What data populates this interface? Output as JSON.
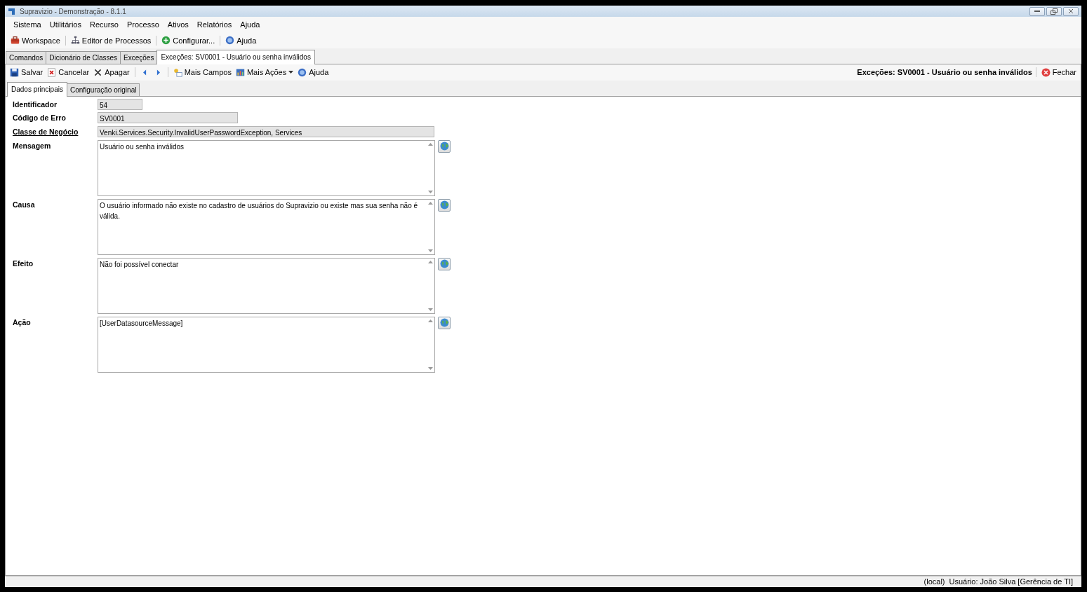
{
  "window": {
    "title": "Supravizio - Demonstração - 8.1.1"
  },
  "menu": [
    "Sistema",
    "Utilitários",
    "Recurso",
    "Processo",
    "Ativos",
    "Relatórios",
    "Ajuda"
  ],
  "toolbar": [
    "Workspace",
    "Editor de Processos",
    "Configurar...",
    "Ajuda"
  ],
  "doc_tabs": [
    {
      "label": "Comandos",
      "selected": false
    },
    {
      "label": "Dicionário de Classes",
      "selected": false
    },
    {
      "label": "Exceções",
      "selected": false
    },
    {
      "label": "Exceções: SV0001 - Usuário ou senha inválidos",
      "selected": true
    }
  ],
  "actions": [
    {
      "label": "Salvar",
      "dropdown": false
    },
    {
      "label": "Cancelar",
      "dropdown": false
    },
    {
      "label": "Apagar",
      "dropdown": false
    },
    {
      "dropdown": false
    },
    {
      "dropdown": false
    },
    {
      "label": "Mais Campos",
      "dropdown": false
    },
    {
      "label": "Mais Ações",
      "dropdown": true
    },
    {
      "label": "Ajuda",
      "dropdown": false
    }
  ],
  "document_title": "Exceções: SV0001 - Usuário ou senha inválidos",
  "close_button": "Fechar",
  "sub_tabs": [
    {
      "label": "Dados principais",
      "selected": true
    },
    {
      "label": "Configuração original",
      "selected": false
    }
  ],
  "fields": [
    {
      "kind": "text",
      "label": "Identificador",
      "value": "54",
      "link": false
    },
    {
      "kind": "text",
      "label": "Código de Erro",
      "value": "SV0001",
      "link": false
    },
    {
      "kind": "text",
      "label": "Classe de Negócio",
      "value": "Venki.Services.Security.InvalidUserPasswordException, Services",
      "link": true
    },
    {
      "kind": "memo",
      "label": "Mensagem",
      "value": "Usuário ou senha inválidos",
      "link": false
    },
    {
      "kind": "memo",
      "label": "Causa",
      "value": "O usuário informado não existe no cadastro de usuários do Supravizio ou existe mas sua senha não é válida.",
      "link": false
    },
    {
      "kind": "memo",
      "label": "Efeito",
      "value": "Não foi possível conectar",
      "link": false
    },
    {
      "kind": "memo",
      "label": "Ação",
      "value": "[UserDatasourceMessage]",
      "link": false
    }
  ],
  "status_bar": [
    "(local)",
    "Usuário: João Silva [Gerência de TI]"
  ]
}
